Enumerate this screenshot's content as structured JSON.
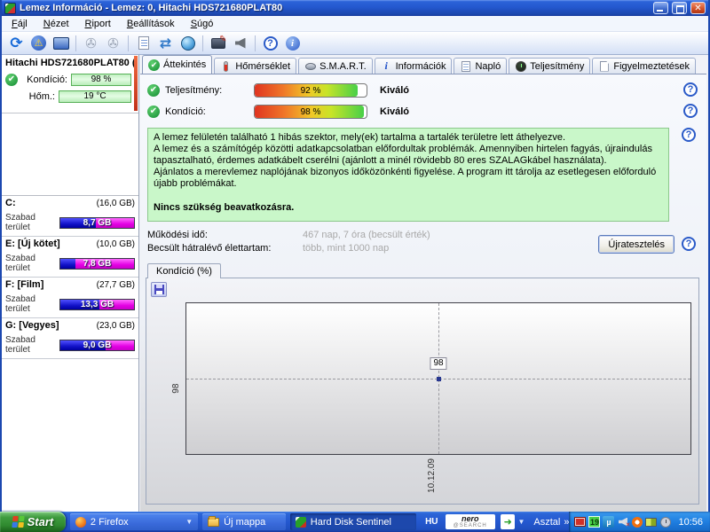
{
  "window": {
    "title": "Lemez Információ - Lemez: 0, Hitachi HDS721680PLAT80"
  },
  "menu": {
    "items": [
      "Fájl",
      "Nézet",
      "Riport",
      "Beállítások",
      "Súgó"
    ]
  },
  "toolbar": {
    "icons": [
      "refresh",
      "alerts",
      "disk-display",
      "detect-disk",
      "remove-disk",
      "report",
      "sync",
      "network",
      "computer-settings",
      "sound",
      "help",
      "info"
    ]
  },
  "sidebar": {
    "disk": {
      "name": "Hitachi HDS721680PLAT80 (",
      "condition_label": "Kondíció:",
      "condition_value": "98 %",
      "temperature_label": "Hőm.:",
      "temperature_value": "19 °C"
    },
    "free_space_label": "Szabad terület",
    "drives": [
      {
        "name": "C:",
        "size": "(16,0 GB)",
        "free": "8,7 GB",
        "used_pct": 48
      },
      {
        "name": "E: [Új kötet]",
        "size": "(10,0 GB)",
        "free": "7,8 GB",
        "used_pct": 21
      },
      {
        "name": "F: [Film]",
        "size": "(27,7 GB)",
        "free": "13,3 GB",
        "used_pct": 53
      },
      {
        "name": "G: [Vegyes]",
        "size": "(23,0 GB)",
        "free": "9,0 GB",
        "used_pct": 61
      }
    ]
  },
  "tabs": [
    {
      "label": "Áttekintés",
      "active": true
    },
    {
      "label": "Hőmérséklet",
      "active": false
    },
    {
      "label": "S.M.A.R.T.",
      "active": false
    },
    {
      "label": "Információk",
      "active": false
    },
    {
      "label": "Napló",
      "active": false
    },
    {
      "label": "Teljesítmény",
      "active": false
    },
    {
      "label": "Figyelmeztetések",
      "active": false
    }
  ],
  "overview": {
    "performance_label": "Teljesítmény:",
    "performance_value": 92,
    "performance_text": "92 %",
    "performance_rating": "Kiváló",
    "condition_label": "Kondíció:",
    "condition_value": 98,
    "condition_text": "98 %",
    "condition_rating": "Kiváló",
    "info_line1": "A lemez felületén található 1 hibás szektor, mely(ek) tartalma a tartalék területre lett áthelyezve.",
    "info_line2": "A lemez és a számítógép közötti adatkapcsolatban előfordultak problémák. Amennyiben hirtelen fagyás, újraindulás tapasztalható, érdemes adatkábelt cserélni (ajánlott a minél rövidebb 80 eres SZALAGkábel használata).",
    "info_line3": "Ajánlatos a merevlemez naplójának bizonyos időközönkénti figyelése. A program itt tárolja az esetlegesen előforduló újabb problémákat.",
    "no_action": "Nincs szükség beavatkozásra.",
    "power_on_label": "Működési idő:",
    "power_on_value": "467 nap, 7 óra (becsült érték)",
    "lifetime_label": "Becsült hátralévő élettartam:",
    "lifetime_value": "több, mint 1000 nap",
    "retest_button": "Újratesztelés"
  },
  "chart_data": {
    "type": "line",
    "title": "Kondíció (%)",
    "x": [
      "10.12.09"
    ],
    "values": [
      98
    ],
    "series": [
      {
        "name": "Kondíció",
        "values": [
          98
        ]
      }
    ],
    "y_tick": "98",
    "point_label": "98",
    "x_tick": "10.12.09",
    "grid": "dashed crosshair at data point",
    "legend": "none"
  },
  "taskbar": {
    "start_label": "Start",
    "tasks": [
      {
        "label": "2 Firefox",
        "active": false
      },
      {
        "label": "Új mappa",
        "active": false
      },
      {
        "label": "Hard Disk Sentinel",
        "active": true
      }
    ],
    "language_indicator": "HU",
    "nero_title": "nero",
    "nero_sub": "@SEARCH",
    "desktop_label": "Asztal",
    "desktop_chevron": "»",
    "tray_temperature": "19",
    "tray_utorrent": "µ",
    "clock": "10:56"
  },
  "colors": {
    "titlebar_blue": "#2458cf",
    "taskbar_blue": "#2458cf",
    "start_green": "#3f9c3f",
    "used_blue": "#1212c8",
    "free_magenta": "#e400e4",
    "status_ok_green": "#128a32",
    "info_box_green": "#c9f7c9",
    "gauge_gradient": "red-to-green"
  }
}
